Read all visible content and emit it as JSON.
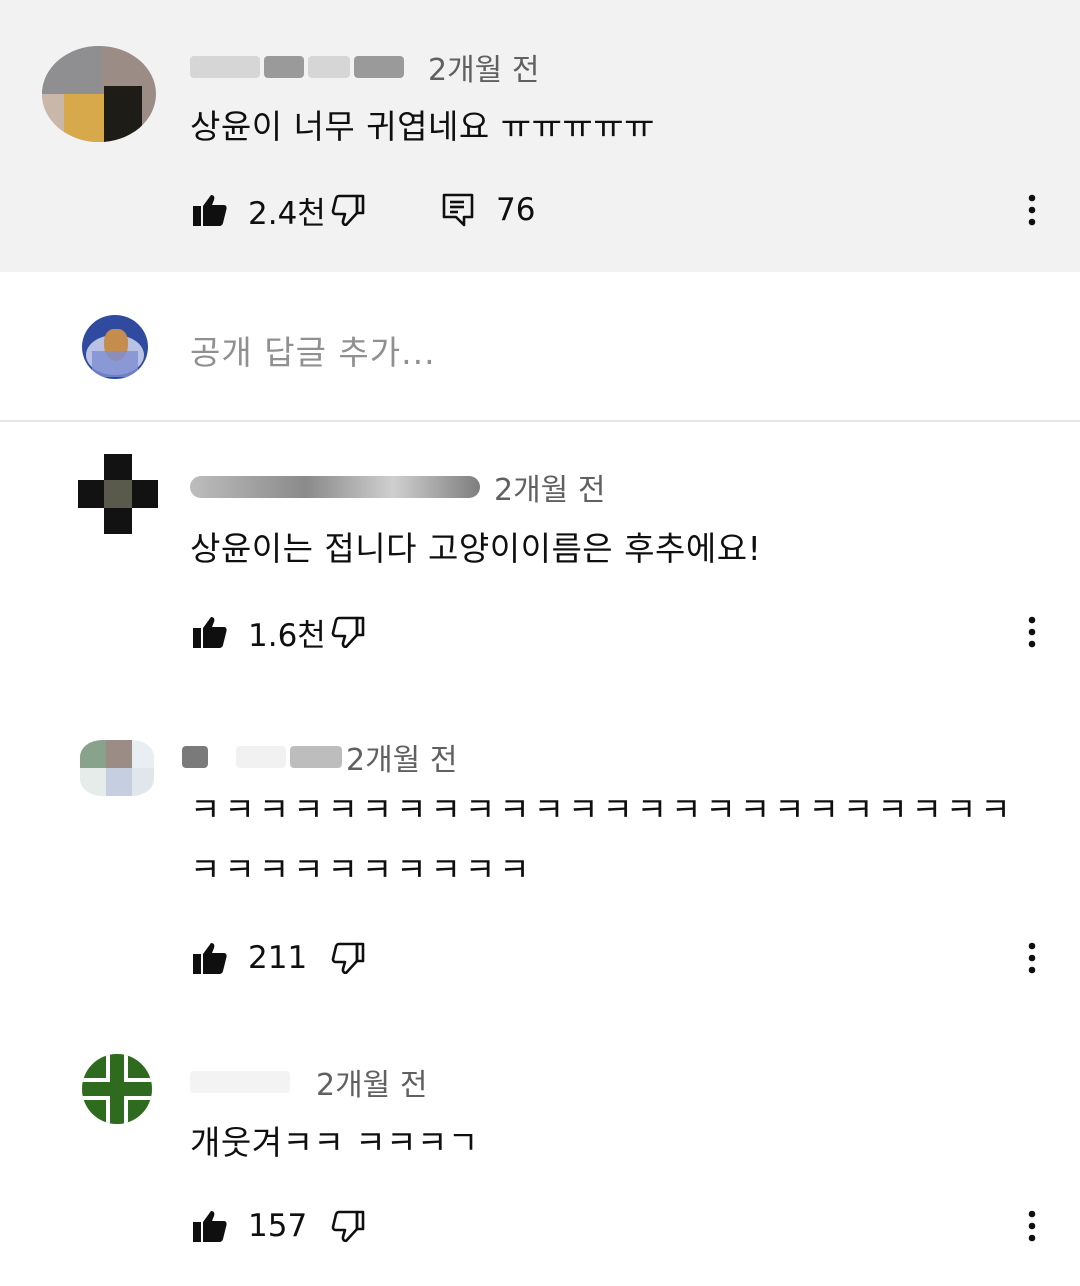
{
  "comments": [
    {
      "time": "2개월 전",
      "text": "상윤이 너무 귀엽네요 ㅠㅠㅠㅠㅠ",
      "likes": "2.4천",
      "replies": "76",
      "icons": {
        "like": "thumb-up-icon",
        "dislike": "thumb-down-icon",
        "reply": "comment-icon",
        "more": "more-vert-icon"
      }
    },
    {
      "time": "2개월 전",
      "text": "상윤이는 접니다 고양이이름은 후추에요!",
      "likes": "1.6천"
    },
    {
      "time": "2개월 전",
      "text": "ㅋㅋㅋㅋㅋㅋㅋㅋㅋㅋㅋㅋㅋㅋㅋㅋㅋㅋㅋㅋㅋㅋㅋㅋㅋㅋㅋㅋㅋㅋㅋㅋㅋㅋ",
      "likes": "211"
    },
    {
      "time": "2개월 전",
      "text": "개웃겨ㅋㅋ ㅋㅋㅋㄱ",
      "likes": "157"
    }
  ],
  "reply_input": {
    "placeholder": "공개 답글 추가..."
  },
  "colors": {
    "top_comment_bg": "#f2f2f2",
    "secondary_text": "#606060",
    "avatar_green": "#2e6b1e"
  }
}
